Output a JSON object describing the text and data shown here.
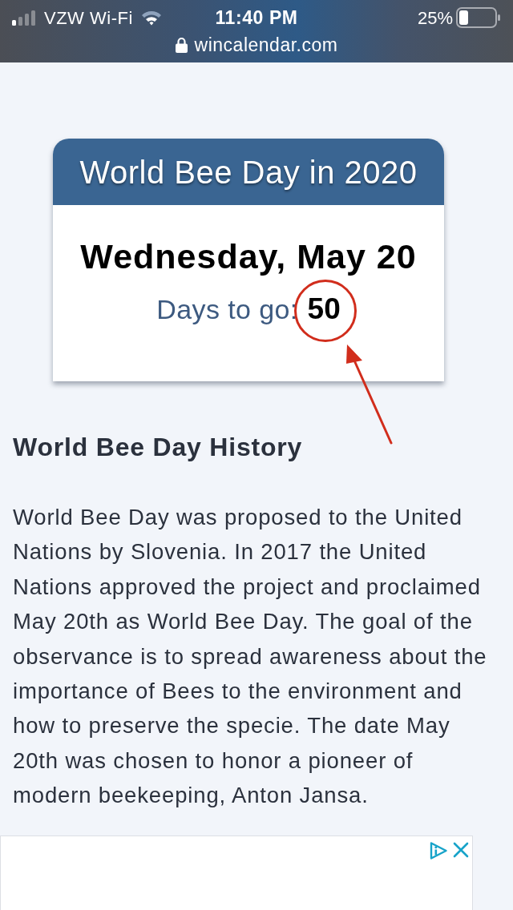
{
  "status_bar": {
    "carrier": "VZW Wi-Fi",
    "time": "11:40 PM",
    "battery": "25%",
    "url": "wincalendar.com"
  },
  "event_card": {
    "title": "World Bee Day in 2020",
    "date": "Wednesday, May 20",
    "countdown_label": "Days to go:",
    "countdown_value": "50",
    "countdown_circled": true,
    "countdown_arrow": true
  },
  "article": {
    "heading": "World Bee Day History",
    "paragraph": "World Bee Day was proposed to the United Nations by Slovenia. In 2017 the United Nations approved the project and proclaimed May 20th as World Bee Day. The goal of the observance is to spread awareness about the importance of Bees to the environment and how to preserve the specie. The date May 20th was chosen to honor a pioneer of modern beekeeping, Anton Jansa."
  },
  "ad": {
    "controls": [
      {
        "kind": "info"
      },
      {
        "kind": "close"
      }
    ]
  }
}
